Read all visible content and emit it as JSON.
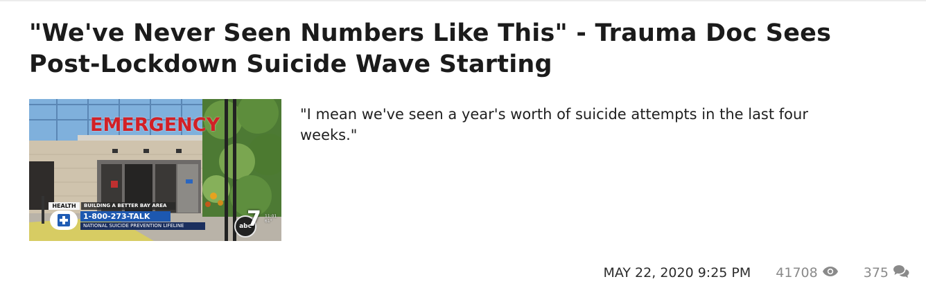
{
  "article": {
    "title": "\"We've Never Seen Numbers Like This\" - Trauma Doc Sees Post-Lockdown Suicide Wave Starting",
    "excerpt": "\"I mean we've seen a year's worth of suicide attempts in the last four weeks.\"",
    "date": "MAY 22, 2020 9:25 PM",
    "views": "41708",
    "comments": "375",
    "views_icon": "eye-icon",
    "comments_icon": "comments-icon"
  },
  "thumbnail": {
    "sign_text": "EMERGENCY",
    "tag": "HEALTH",
    "topic": "BUILDING A BETTER BAY AREA",
    "phone": "1-800-273-TALK",
    "subtitle": "NATIONAL SUICIDE PREVENTION LIFELINE",
    "network": "abc",
    "channel": "7",
    "time": "11:01",
    "temp": "61°"
  },
  "colors": {
    "title": "#1b1b1b",
    "meta": "#8a8a8a",
    "sign_red": "#d22026",
    "lifeline_blue": "#1d58b0"
  }
}
